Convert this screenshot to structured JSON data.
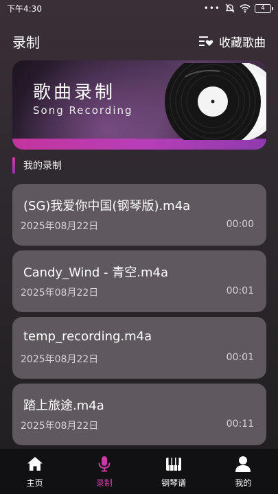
{
  "status_bar": {
    "time": "下午4:30",
    "dots": "•••",
    "battery": "4"
  },
  "header": {
    "title": "录制",
    "favorites_label": "收藏歌曲"
  },
  "banner": {
    "title": "歌曲录制",
    "subtitle": "Song Recording"
  },
  "section": {
    "title": "我的录制"
  },
  "recordings": [
    {
      "name": "(SG)我爱你中国(钢琴版).m4a",
      "date": "2025年08月22日",
      "duration": "00:00"
    },
    {
      "name": "Candy_Wind - 青空.m4a",
      "date": "2025年08月22日",
      "duration": "00:01"
    },
    {
      "name": "temp_recording.m4a",
      "date": "2025年08月22日",
      "duration": "00:01"
    },
    {
      "name": "踏上旅途.m4a",
      "date": "2025年08月22日",
      "duration": "00:11"
    }
  ],
  "nav": [
    {
      "label": "主页",
      "icon": "home-icon"
    },
    {
      "label": "录制",
      "icon": "microphone-icon",
      "active": true
    },
    {
      "label": "钢琴谱",
      "icon": "piano-icon"
    },
    {
      "label": "我的",
      "icon": "user-icon"
    }
  ],
  "colors": {
    "accent": "#c93ca7",
    "card": "#5f585f",
    "nav_background": "#111012"
  }
}
